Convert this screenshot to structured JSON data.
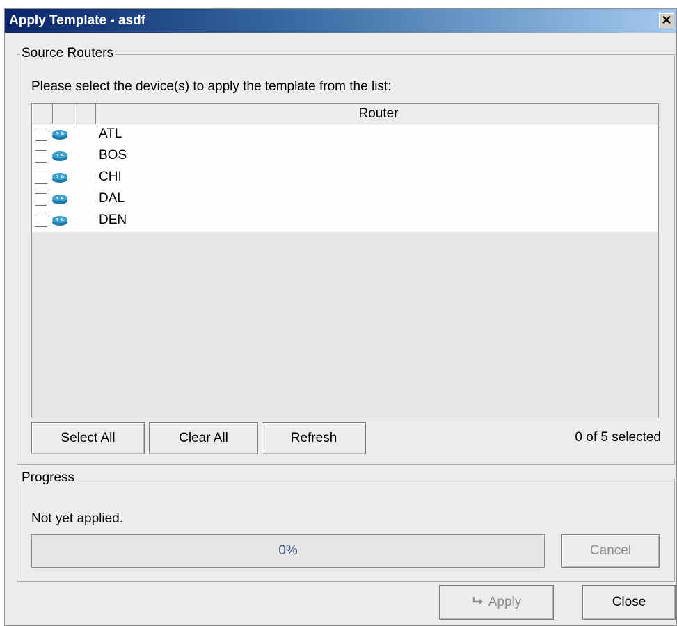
{
  "window": {
    "title": "Apply Template - asdf",
    "close_glyph": "✕"
  },
  "source_routers": {
    "legend": "Source Routers",
    "instruction": "Please select the device(s) to apply the template from the list:",
    "columns": [
      "",
      "",
      "",
      "Router"
    ],
    "routers": [
      {
        "name": "ATL",
        "checked": false,
        "icon": "router-icon"
      },
      {
        "name": "BOS",
        "checked": false,
        "icon": "router-icon"
      },
      {
        "name": "CHI",
        "checked": false,
        "icon": "router-icon"
      },
      {
        "name": "DAL",
        "checked": false,
        "icon": "router-icon"
      },
      {
        "name": "DEN",
        "checked": false,
        "icon": "router-icon"
      }
    ],
    "buttons": {
      "select_all": "Select All",
      "clear_all": "Clear All",
      "refresh": "Refresh"
    },
    "selection_count": "0 of 5 selected"
  },
  "progress": {
    "legend": "Progress",
    "status": "Not yet applied.",
    "value_percent": 0,
    "label": "0%",
    "cancel": "Cancel"
  },
  "footer": {
    "apply": "Apply",
    "apply_icon": "apply-arrow-icon",
    "close": "Close"
  },
  "colors": {
    "title_start": "#0a246a",
    "title_end": "#a6caf0",
    "router_icon": "#2a8fbf",
    "progress_text": "#4a5f8a"
  }
}
